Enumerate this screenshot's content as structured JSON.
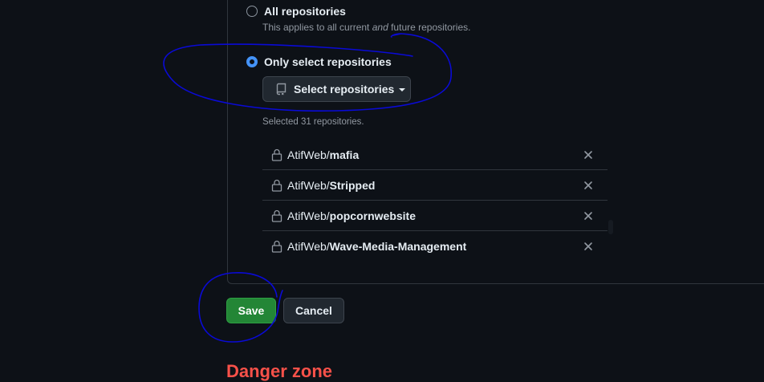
{
  "access": {
    "all_option": {
      "label": "All repositories",
      "description_prefix": "This applies to all current ",
      "description_emphasis": "and",
      "description_suffix": " future repositories.",
      "checked": false
    },
    "select_option": {
      "label": "Only select repositories",
      "checked": true
    },
    "select_button": {
      "label": "Select repositories",
      "icon": "repo-icon"
    },
    "selected_count_text": "Selected 31 repositories.",
    "repositories": [
      {
        "owner": "AtifWeb/",
        "name": "mafia"
      },
      {
        "owner": "AtifWeb/",
        "name": "Stripped"
      },
      {
        "owner": "AtifWeb/",
        "name": "popcornwebsite"
      },
      {
        "owner": "AtifWeb/",
        "name": "Wave-Media-Management"
      }
    ]
  },
  "actions": {
    "save_label": "Save",
    "cancel_label": "Cancel"
  },
  "danger_zone": {
    "title": "Danger zone"
  },
  "colors": {
    "background": "#0d1117",
    "accent": "#4493f8",
    "primary_button": "#238636",
    "danger": "#f85149",
    "annotation_ink": "#0a0ad6"
  }
}
